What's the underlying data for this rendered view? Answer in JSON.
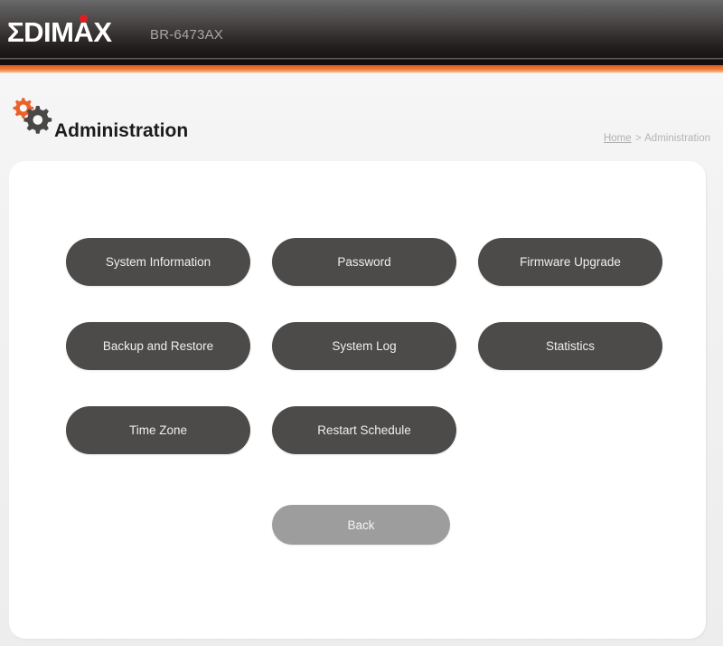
{
  "header": {
    "brand": "EDIMAX",
    "brand_first_letter": "Σ",
    "brand_rest": "DIMAX",
    "model": "BR-6473AX",
    "logo_dot_color": "#e02020",
    "accent_color": "#e8692a"
  },
  "page": {
    "title": "Administration",
    "icon": "gears-icon",
    "gear_orange_color": "#e8622a",
    "gear_dark_color": "#4d4b4a"
  },
  "breadcrumb": {
    "home": "Home",
    "separator": ">",
    "current": "Administration"
  },
  "main": {
    "buttons": [
      {
        "label": "System Information",
        "name": "system-information"
      },
      {
        "label": "Password",
        "name": "password"
      },
      {
        "label": "Firmware Upgrade",
        "name": "firmware-upgrade"
      },
      {
        "label": "Backup and Restore",
        "name": "backup-and-restore"
      },
      {
        "label": "System Log",
        "name": "system-log"
      },
      {
        "label": "Statistics",
        "name": "statistics"
      },
      {
        "label": "Time Zone",
        "name": "time-zone"
      },
      {
        "label": "Restart Schedule",
        "name": "restart-schedule"
      }
    ],
    "back_label": "Back",
    "button_color": "#4d4b4a",
    "back_button_color": "#9d9d9d"
  }
}
